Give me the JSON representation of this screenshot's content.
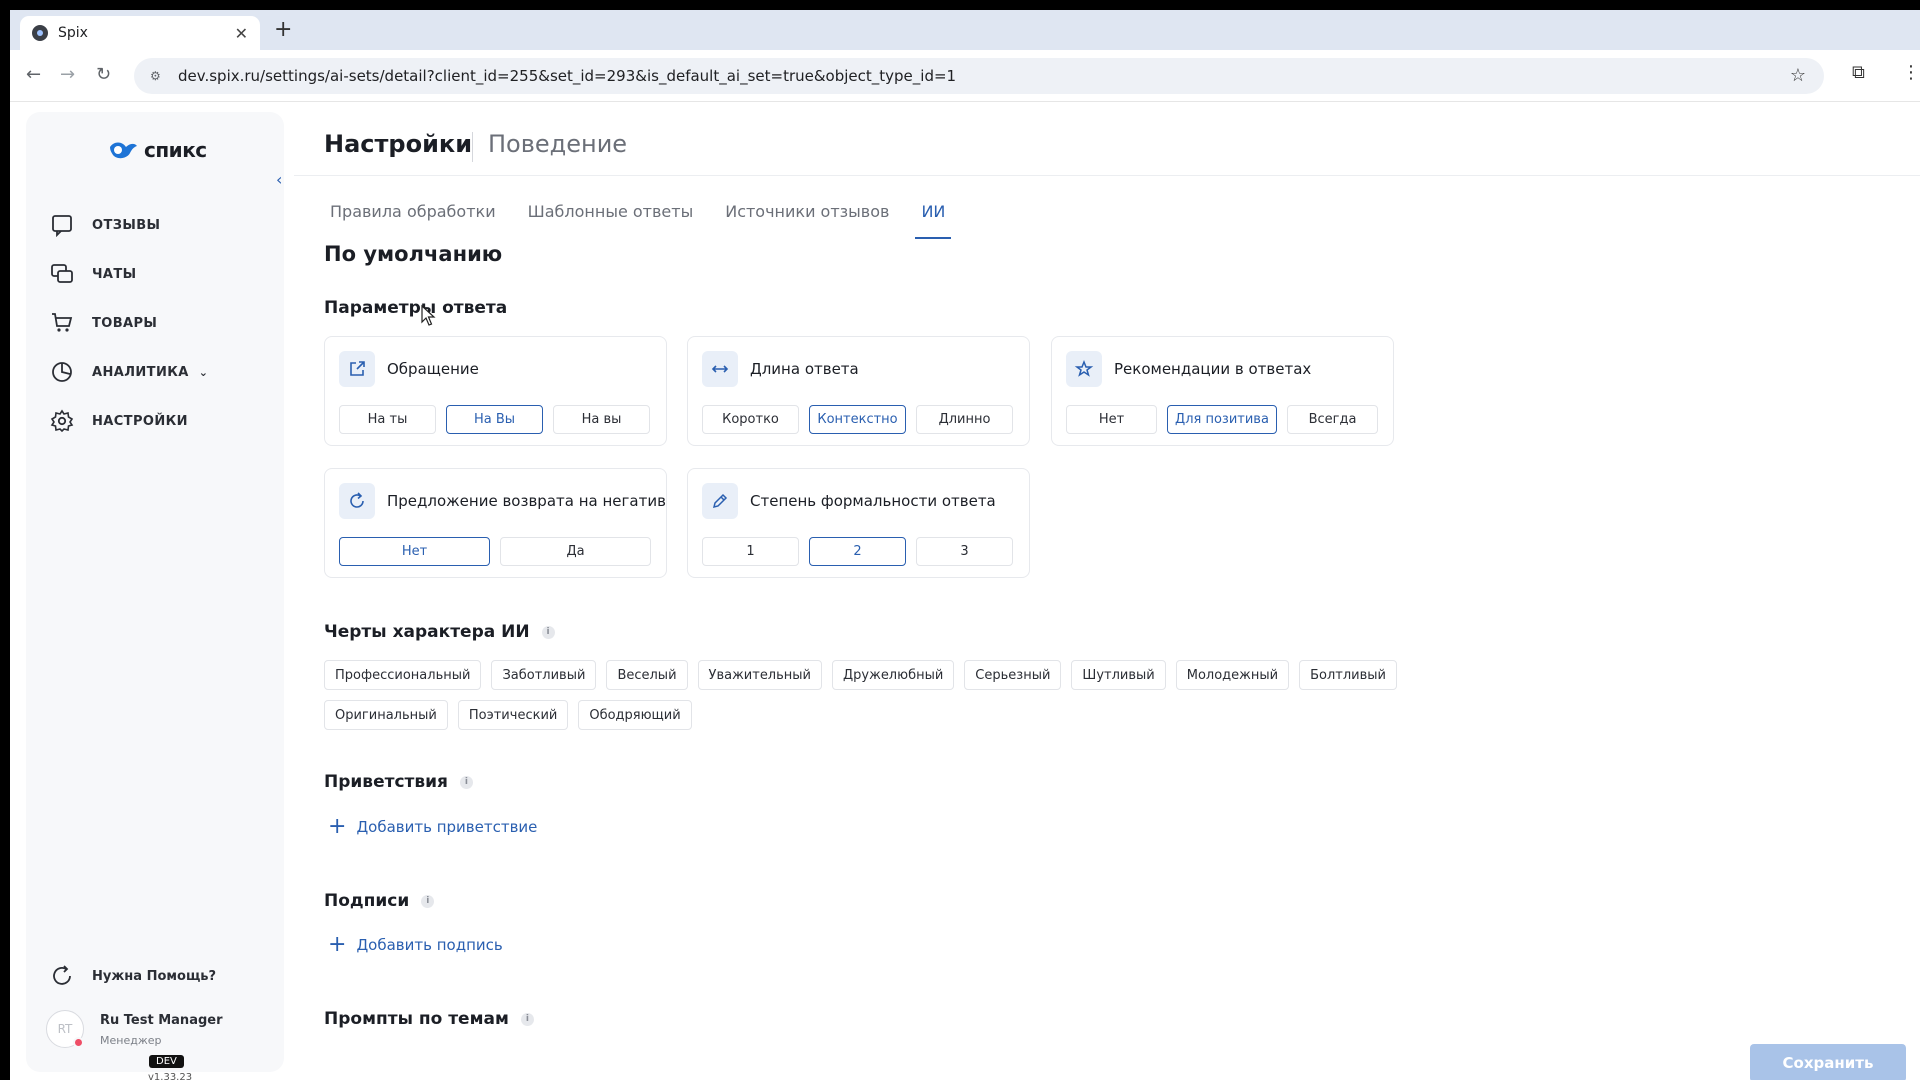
{
  "browser": {
    "tab_title": "Spix",
    "tab_close": "✕",
    "new_tab": "+",
    "url": "dev.spix.ru/settings/ai-sets/detail?client_id=255&set_id=293&is_default_ai_set=true&object_type_id=1"
  },
  "sidebar": {
    "logo_text": "спикс",
    "items": [
      {
        "label": "ОТЗЫВЫ",
        "icon": "reviews-icon"
      },
      {
        "label": "ЧАТЫ",
        "icon": "chats-icon"
      },
      {
        "label": "ТОВАРЫ",
        "icon": "cart-icon"
      },
      {
        "label": "АНАЛИТИКА",
        "icon": "analytics-icon"
      },
      {
        "label": "НАСТРОЙКИ",
        "icon": "gear-icon"
      }
    ],
    "help_label": "Нужна Помощь?",
    "user_initials": "RT",
    "user_name": "Ru Test Manager",
    "user_role": "Менеджер",
    "env_badge": "DEV",
    "version": "v1.33.23"
  },
  "header": {
    "title": "Настройки",
    "subtitle": "Поведение"
  },
  "tabs": [
    "Правила обработки",
    "Шаблонные ответы",
    "Источники отзывов",
    "ИИ"
  ],
  "active_tab": "ИИ",
  "page": {
    "set_title": "По умолчанию",
    "params_title": "Параметры ответа"
  },
  "cards": {
    "address": {
      "title": "Обращение",
      "options": [
        "На ты",
        "На Вы",
        "На вы"
      ],
      "selected": "На Вы"
    },
    "length": {
      "title": "Длина ответа",
      "options": [
        "Коротко",
        "Контекстно",
        "Длинно"
      ],
      "selected": "Контекстно"
    },
    "recommend": {
      "title": "Рекомендации в ответах",
      "options": [
        "Нет",
        "Для позитива",
        "Всегда"
      ],
      "selected": "Для позитива"
    },
    "refund": {
      "title": "Предложение возврата на негатив",
      "options": [
        "Нет",
        "Да"
      ],
      "selected": "Нет"
    },
    "formality": {
      "title": "Степень формальности ответа",
      "options": [
        "1",
        "2",
        "3"
      ],
      "selected": "2"
    }
  },
  "traits": {
    "title": "Черты характера ИИ",
    "items": [
      "Профессиональный",
      "Заботливый",
      "Веселый",
      "Уважительный",
      "Дружелюбный",
      "Серьезный",
      "Шутливый",
      "Молодежный",
      "Болтливый",
      "Оригинальный",
      "Поэтический",
      "Ободряющий"
    ]
  },
  "greetings": {
    "title": "Приветствия",
    "add_label": "Добавить приветствие"
  },
  "signatures": {
    "title": "Подписи",
    "add_label": "Добавить подпись"
  },
  "prompts": {
    "title": "Промпты по темам"
  },
  "save_label": "Сохранить",
  "colors": {
    "accent": "#2a5fb0",
    "save_disabled": "#a9c3e8",
    "badge_red": "#ef4e66"
  }
}
